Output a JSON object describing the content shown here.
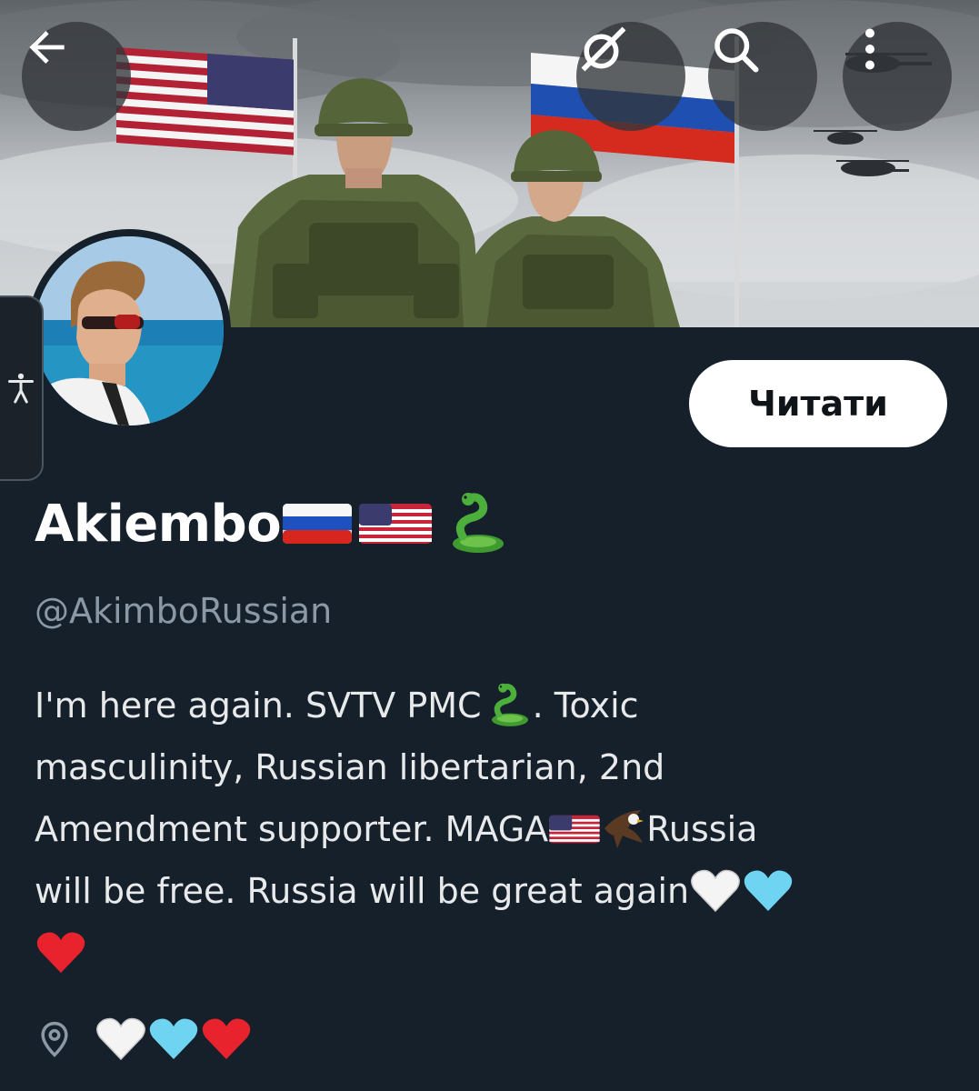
{
  "header": {
    "back_icon": "arrow-left-icon",
    "grok_icon": "grok-icon",
    "search_icon": "search-icon",
    "more_icon": "more-vertical-icon"
  },
  "profile": {
    "display_name": "Akiembo",
    "name_emojis": [
      "flag-russia",
      "flag-usa",
      "snake"
    ],
    "handle": "@AkimboRussian",
    "follow_label": "Читати"
  },
  "bio": {
    "line1_a": "I'm here again. SVTV PMC",
    "line1_b": ". Toxic",
    "line2": "masculinity,  Russian libertarian, 2nd",
    "line3_a": "Amendment supporter. MAGA",
    "line3_b": " Russia",
    "line4": "will be free. Russia will be great again"
  },
  "location": {
    "icon": "location-pin-icon",
    "emojis": [
      "white-heart",
      "light-blue-heart",
      "red-heart"
    ]
  },
  "accessibility_tab": {
    "icon": "accessibility-icon"
  },
  "colors": {
    "background": "#15202b",
    "text": "#e7e9ea",
    "muted": "#8b98a5",
    "follow_bg": "#ffffff"
  }
}
